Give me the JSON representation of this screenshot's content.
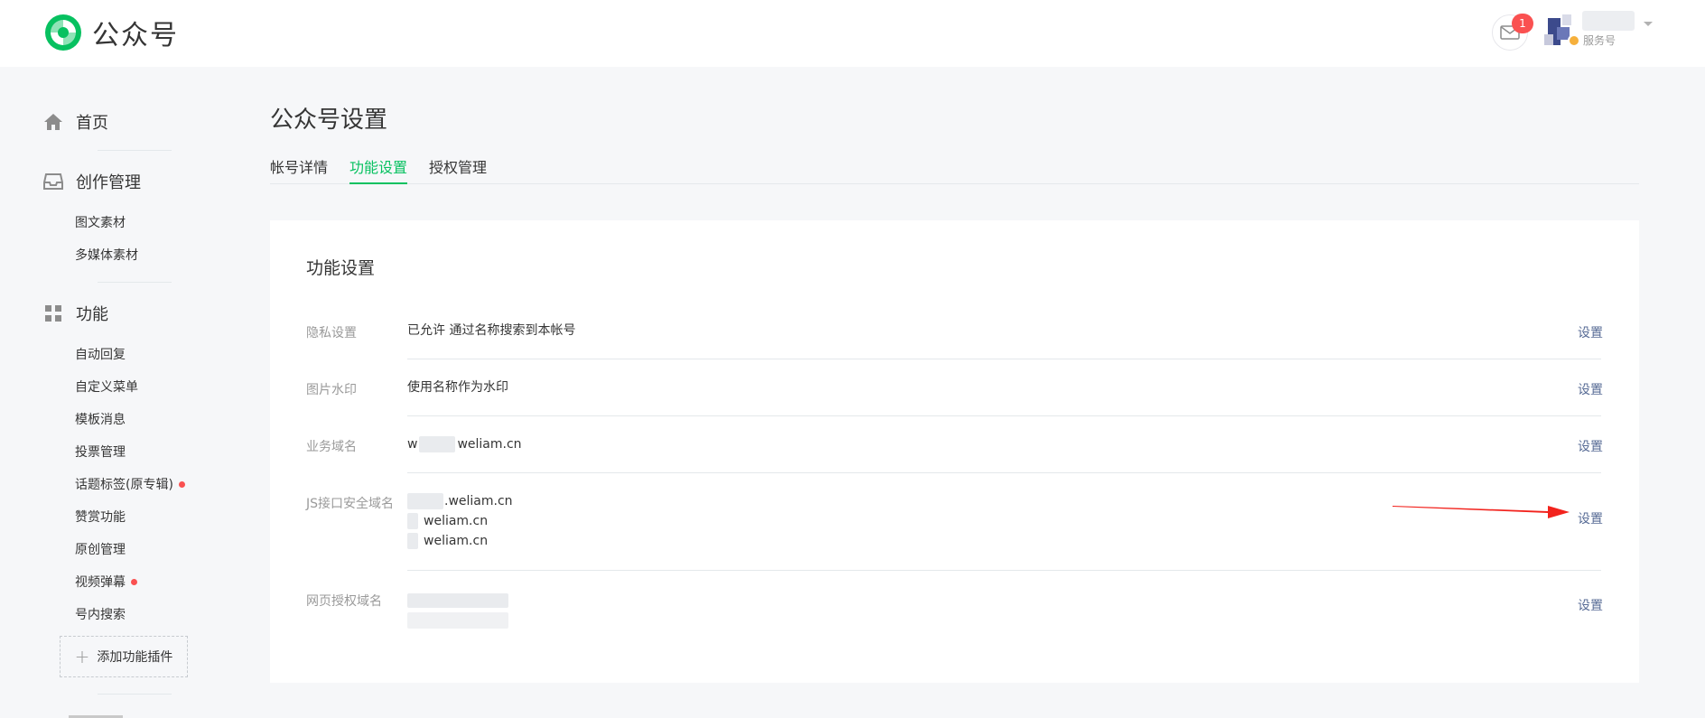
{
  "header": {
    "app_name": "公众号",
    "mail_badge_count": "1",
    "account_type": "服务号"
  },
  "sidebar": {
    "home_label": "首页",
    "creation": {
      "label": "创作管理",
      "items": [
        "图文素材",
        "多媒体素材"
      ]
    },
    "features": {
      "label": "功能",
      "items": [
        {
          "label": "自动回复",
          "dot": false
        },
        {
          "label": "自定义菜单",
          "dot": false
        },
        {
          "label": "模板消息",
          "dot": false
        },
        {
          "label": "投票管理",
          "dot": false
        },
        {
          "label": "话题标签(原专辑)",
          "dot": true
        },
        {
          "label": "赞赏功能",
          "dot": false
        },
        {
          "label": "原创管理",
          "dot": false
        },
        {
          "label": "视频弹幕",
          "dot": true
        },
        {
          "label": "号内搜索",
          "dot": false
        }
      ]
    },
    "add_plugin_label": "添加功能插件"
  },
  "main": {
    "page_title": "公众号设置",
    "tabs": [
      {
        "label": "帐号详情",
        "active": false
      },
      {
        "label": "功能设置",
        "active": true
      },
      {
        "label": "授权管理",
        "active": false
      }
    ],
    "card": {
      "title": "功能设置",
      "action_label": "设置",
      "rows": [
        {
          "label": "隐私设置",
          "lines": [
            "已允许 通过名称搜索到本帐号"
          ]
        },
        {
          "label": "图片水印",
          "lines": [
            "使用名称作为水印"
          ]
        },
        {
          "label": "业务域名",
          "lines": [
            "weliam.cn"
          ]
        },
        {
          "label": "JS接口安全域名",
          "lines": [
            ".weliam.cn",
            "weliam.cn",
            "weliam.cn"
          ]
        },
        {
          "label": "网页授权域名",
          "lines": []
        }
      ]
    }
  },
  "colors": {
    "accent_green": "#07c160",
    "link_blue": "#576b95",
    "badge_red": "#fa5151",
    "arrow_red": "#f2231d"
  }
}
